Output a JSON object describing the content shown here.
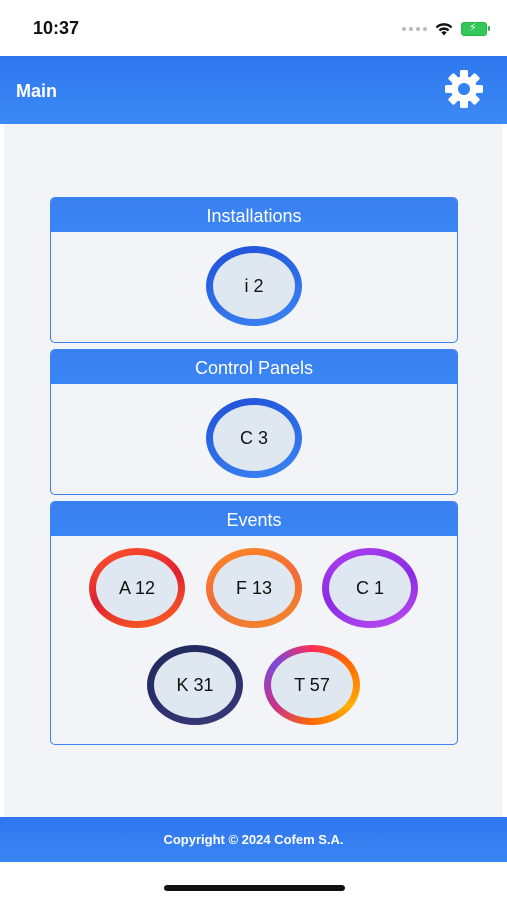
{
  "status_bar": {
    "time": "10:37",
    "battery_color": "#34c759"
  },
  "header": {
    "title": "Main",
    "settings_icon": "gear-icon",
    "background": "#3081f0"
  },
  "cards": {
    "installations": {
      "title": "Installations",
      "items": [
        {
          "label": "i 2",
          "ring": "blue"
        }
      ]
    },
    "control_panels": {
      "title": "Control Panels",
      "items": [
        {
          "label": "C 3",
          "ring": "blue"
        }
      ]
    },
    "events": {
      "title": "Events",
      "items": [
        {
          "label": "A 12",
          "ring": "red"
        },
        {
          "label": "F 13",
          "ring": "orange"
        },
        {
          "label": "C 1",
          "ring": "purple"
        },
        {
          "label": "K 31",
          "ring": "navy"
        },
        {
          "label": "T 57",
          "ring": "multicolor"
        }
      ]
    }
  },
  "footer": {
    "copyright": "Copyright © 2024 Cofem S.A."
  },
  "colors": {
    "accent": "#3b82f6",
    "content_background": "#f2f4f7",
    "circle_fill": "#dfe8f0"
  }
}
